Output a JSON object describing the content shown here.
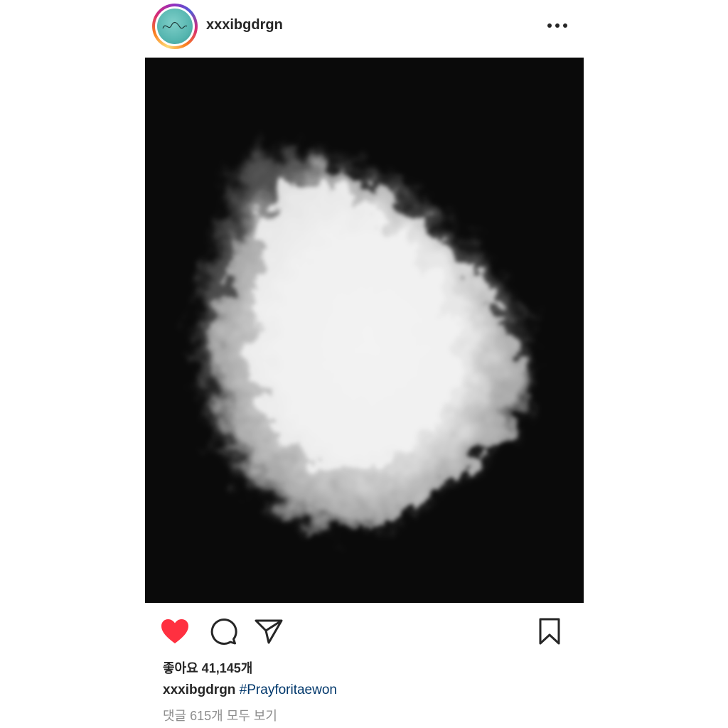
{
  "header": {
    "username": "xxxibgdrgn",
    "avatar_icon": "profile-avatar",
    "more_icon": "more-horizontal-icon"
  },
  "post": {
    "image_alt": "white-powder-cloud-on-black"
  },
  "actions": {
    "like_icon": "heart-filled-icon",
    "comment_icon": "comment-icon",
    "share_icon": "send-icon",
    "save_icon": "bookmark-icon",
    "like_color": "#ff3040"
  },
  "likes": {
    "text": "좋아요 41,145개"
  },
  "caption": {
    "username": "xxxibgdrgn",
    "hashtag": "#Prayforitaewon"
  },
  "comments": {
    "view_all_text": "댓글 615개 모두 보기"
  },
  "colors": {
    "text": "#262626",
    "hashtag": "#00376b",
    "muted": "#8e8e8e",
    "image_background": "#050505"
  }
}
